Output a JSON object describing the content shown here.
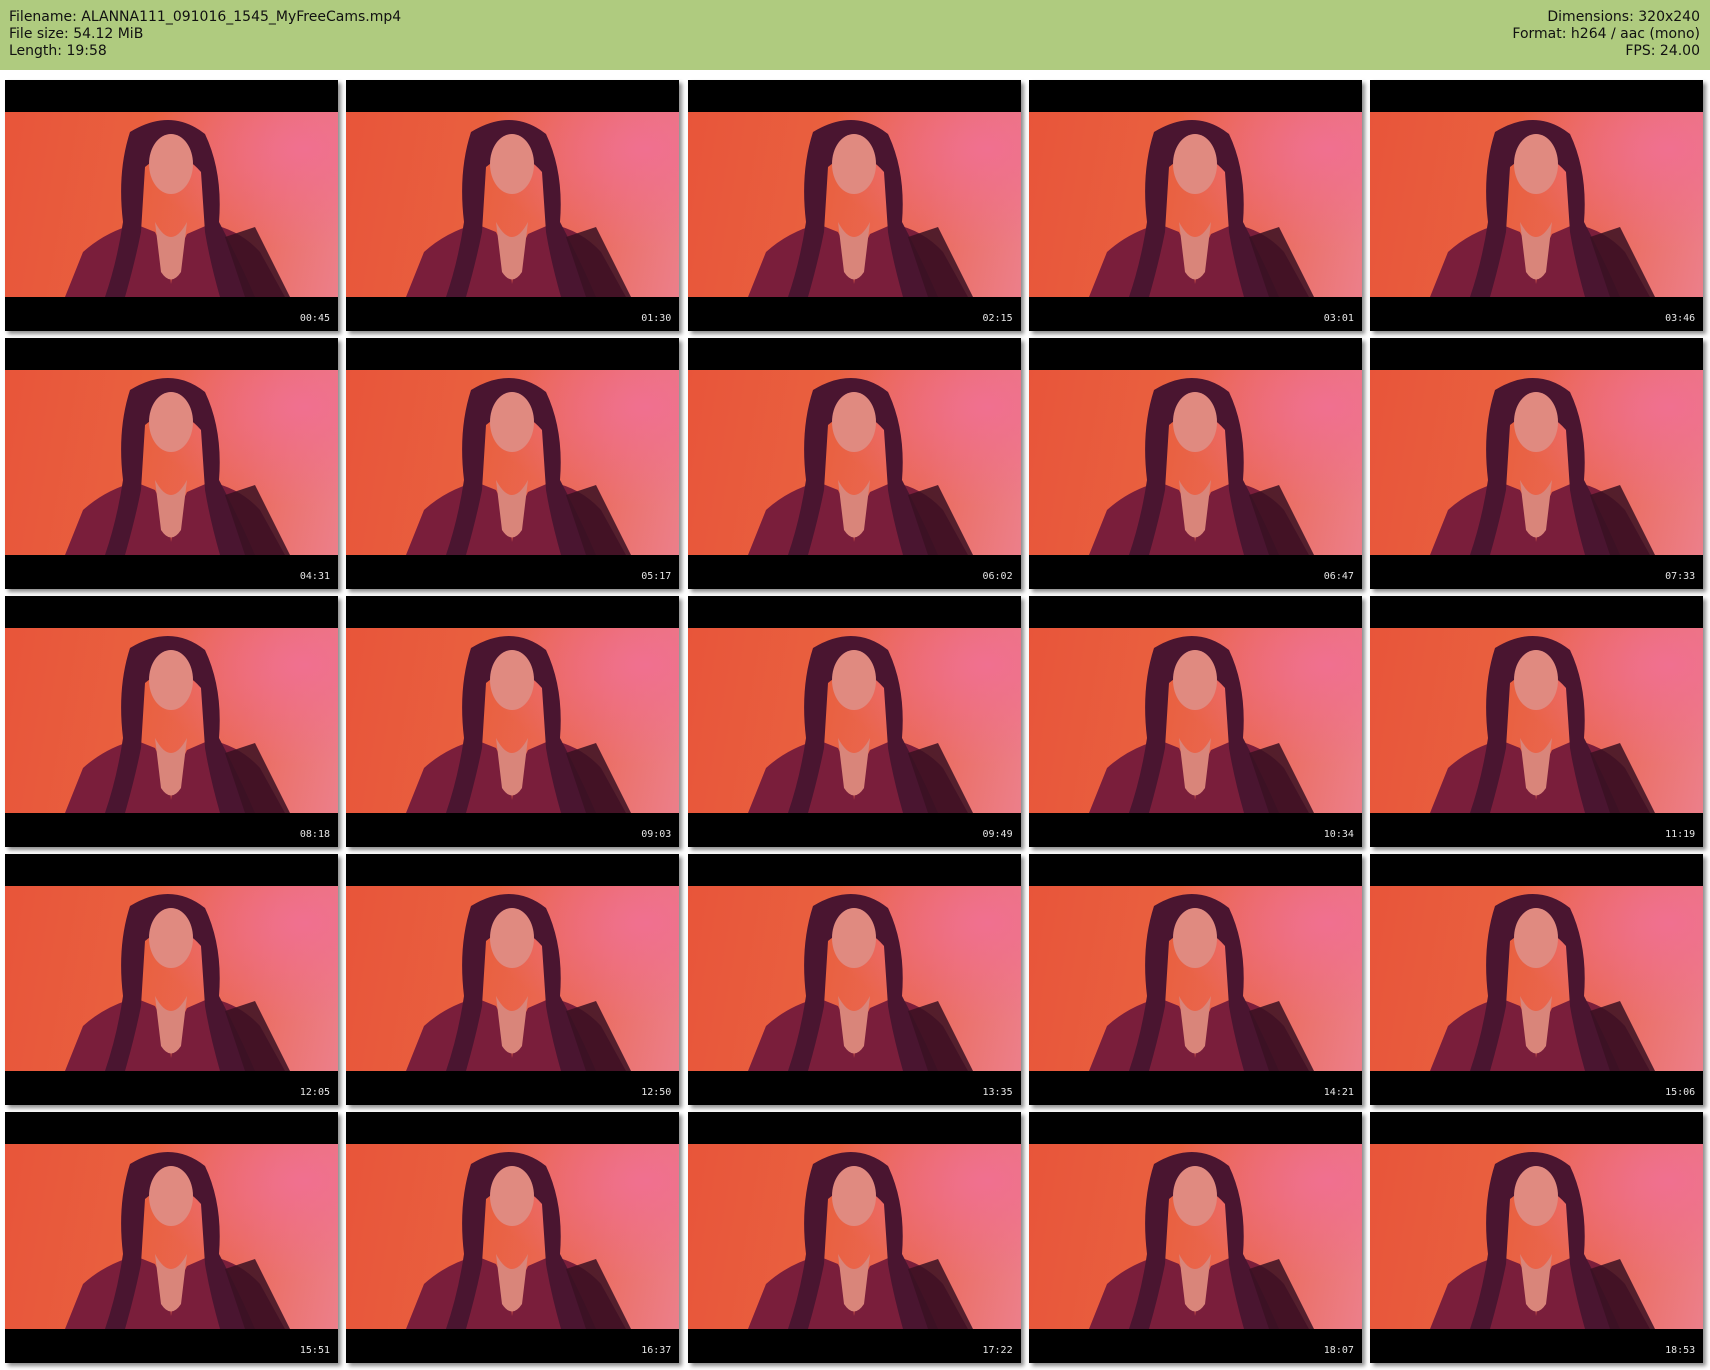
{
  "header": {
    "filename": "Filename: ALANNA111_091016_1545_MyFreeCams.mp4",
    "filesize": "File size: 54.12 MiB",
    "length": "Length: 19:58",
    "dimensions": "Dimensions: 320x240",
    "format": "Format: h264 / aac (mono)",
    "fps": "FPS: 24.00"
  },
  "colors": {
    "header_bg": "#afcb7f",
    "page_bg": "#ffffff"
  },
  "thumbnails": [
    "00:45",
    "01:30",
    "02:15",
    "03:01",
    "03:46",
    "04:31",
    "05:17",
    "06:02",
    "06:47",
    "07:33",
    "08:18",
    "09:03",
    "09:49",
    "10:34",
    "11:19",
    "12:05",
    "12:50",
    "13:35",
    "14:21",
    "15:06",
    "15:51",
    "16:37",
    "17:22",
    "18:07",
    "18:53"
  ],
  "columns": 5
}
